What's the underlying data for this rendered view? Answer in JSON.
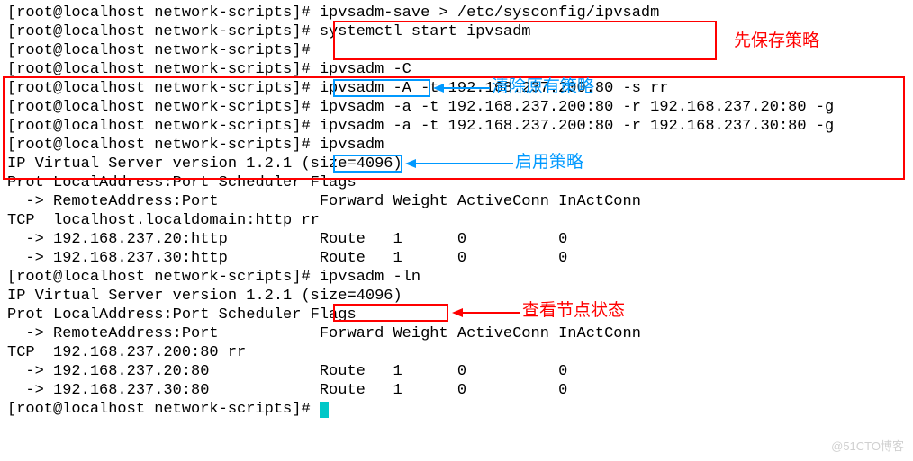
{
  "prompt": "[root@localhost network-scripts]# ",
  "lines": {
    "l1": "ipvsadm-save > /etc/sysconfig/ipvsadm",
    "l2": "systemctl start ipvsadm",
    "l3": "",
    "l4": "ipvsadm -C",
    "l5": "ipvsadm -A -t 192.168.237.200:80 -s rr",
    "l6": "ipvsadm -a -t 192.168.237.200:80 -r 192.168.237.20:80 -g",
    "l7": "ipvsadm -a -t 192.168.237.200:80 -r 192.168.237.30:80 -g",
    "l8": "ipvsadm",
    "o1": "IP Virtual Server version 1.2.1 (size=4096)",
    "o2": "Prot LocalAddress:Port Scheduler Flags",
    "o3": "  -> RemoteAddress:Port           Forward Weight ActiveConn InActConn",
    "o4": "TCP  localhost.localdomain:http rr",
    "o5": "  -> 192.168.237.20:http          Route   1      0          0         ",
    "o6": "  -> 192.168.237.30:http          Route   1      0          0         ",
    "l9": "ipvsadm -ln",
    "o7": "IP Virtual Server version 1.2.1 (size=4096)",
    "o8": "Prot LocalAddress:Port Scheduler Flags",
    "o9": "  -> RemoteAddress:Port           Forward Weight ActiveConn InActConn",
    "o10": "TCP  192.168.237.200:80 rr",
    "o11": "  -> 192.168.237.20:80            Route   1      0          0         ",
    "o12": "  -> 192.168.237.30:80            Route   1      0          0         "
  },
  "annotations": {
    "save_first": "先保存策略",
    "clear_old": "清除原有策略",
    "enable": "启用策略",
    "view_nodes": "查看节点状态"
  },
  "watermark": "@51CTO博客"
}
